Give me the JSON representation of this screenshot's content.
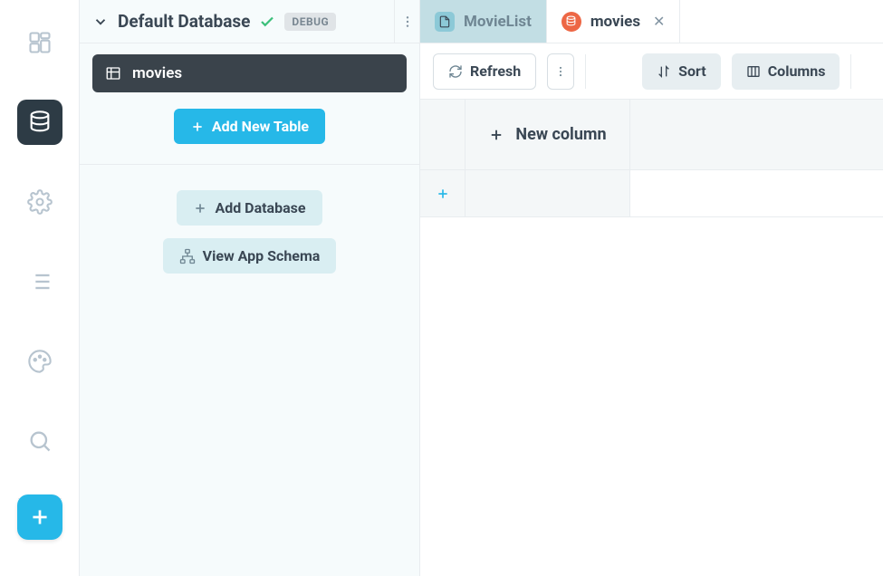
{
  "rail": {
    "items": [
      {
        "name": "components-icon"
      },
      {
        "name": "database-icon"
      },
      {
        "name": "settings-icon"
      },
      {
        "name": "list-icon"
      },
      {
        "name": "palette-icon"
      },
      {
        "name": "search-icon"
      }
    ],
    "active_index": 1
  },
  "sidebar": {
    "database_title": "Default Database",
    "debug_label": "DEBUG",
    "tables": [
      {
        "name": "movies"
      }
    ],
    "add_table_label": "Add New Table",
    "add_database_label": "Add Database",
    "view_schema_label": "View App Schema"
  },
  "tabs": [
    {
      "label": "MovieList",
      "kind": "component",
      "active": false
    },
    {
      "label": "movies",
      "kind": "table",
      "active": true
    }
  ],
  "toolbar": {
    "refresh_label": "Refresh",
    "sort_label": "Sort",
    "columns_label": "Columns"
  },
  "grid": {
    "new_column_label": "New column"
  }
}
